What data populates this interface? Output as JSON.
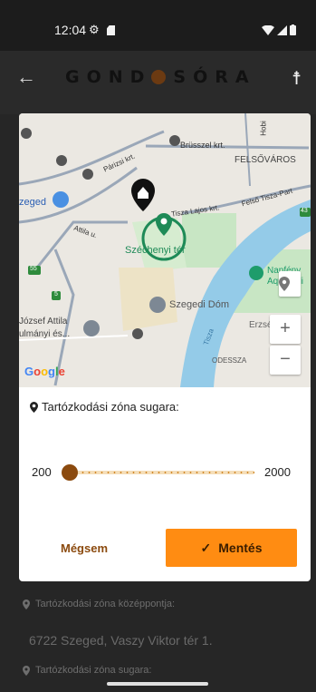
{
  "status_bar": {
    "time": "12:04",
    "gear_glyph": "⚙",
    "sd_icon": "sd-card-icon",
    "wifi_icon": "wifi-icon",
    "signal_icon": "signal-icon",
    "battery_icon": "battery-icon"
  },
  "header": {
    "back_glyph": "←",
    "logo_left": "GOND",
    "logo_right": "SÓRA",
    "accessibility_glyph": "☨"
  },
  "map": {
    "labels": {
      "brusszel": "Brüsszel krt.",
      "hobi": "Hobi",
      "felsovaros": "FELSŐVÁROS",
      "parizsi": "Párizsi krt.",
      "tisza_lajos": "Tisza Lajos krt.",
      "felso_tisza": "Felső Tisza-Part",
      "szeged": "zeged",
      "attila": "Attila u.",
      "szechenyi": "Széchenyi tér",
      "napfeny": "Napfény",
      "aqua": "AquaPoli",
      "dom": "Szegedi Dóm",
      "erzsebet": "Erzsébet lig",
      "jozsef": "József Attila",
      "tudomanyi": "ulmányi és...",
      "odessza": "ODESSZA",
      "tisza": "Tisza",
      "road_43": "43",
      "road_55": "55",
      "road_5": "5"
    },
    "google": [
      "G",
      "o",
      "o",
      "g",
      "l",
      "e"
    ],
    "zoom_in": "+",
    "zoom_out": "−"
  },
  "dialog": {
    "radius_title": "Tartózkodási zóna sugara:",
    "slider_min": "200",
    "slider_max": "2000",
    "slider_value": 200,
    "cancel_label": "Mégsem",
    "save_label": "Mentés",
    "save_glyph": "✓"
  },
  "background": {
    "center_label": "Tartózkodási zóna középpontja:",
    "center_value": "6722 Szeged, Vaszy Viktor tér 1.",
    "radius_label": "Tartózkodási zóna sugara:"
  },
  "colors": {
    "accent": "#ff8c12",
    "brown": "#8b4a0e",
    "marker_green": "#1e8a57"
  }
}
